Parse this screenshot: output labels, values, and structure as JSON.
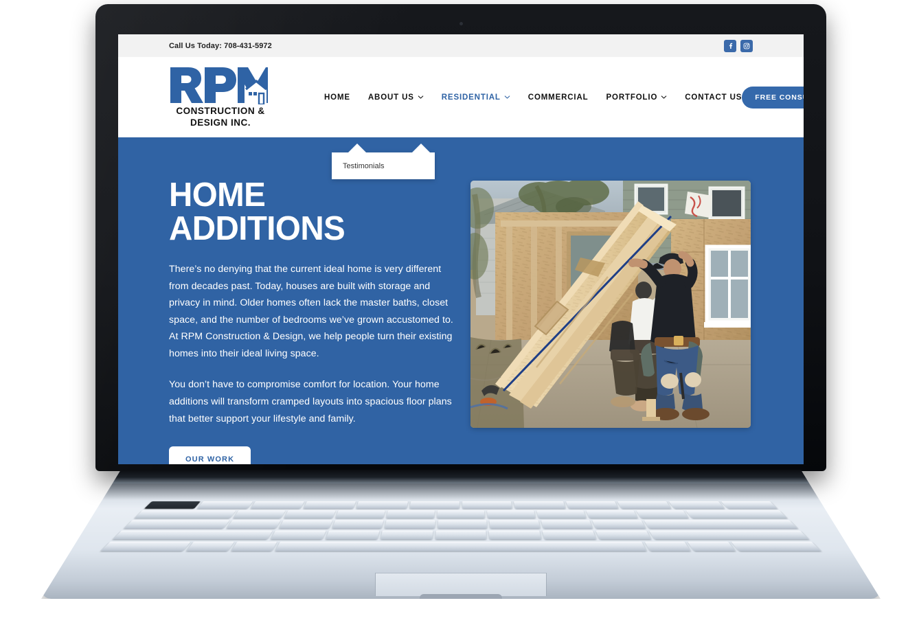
{
  "site": {
    "topbar": {
      "phone_label": "Call Us Today: 708-431-5972",
      "social": [
        {
          "name": "facebook",
          "glyph": "f"
        },
        {
          "name": "instagram",
          "glyph": "◎"
        }
      ]
    },
    "logo": {
      "mark_text": "RPM",
      "line1": "CONSTRUCTION &",
      "line2": "DESIGN INC."
    },
    "nav": {
      "items": [
        {
          "label": "HOME",
          "has_caret": false,
          "active": false
        },
        {
          "label": "ABOUT US",
          "has_caret": true,
          "active": false
        },
        {
          "label": "RESIDENTIAL",
          "has_caret": true,
          "active": true
        },
        {
          "label": "COMMERCIAL",
          "has_caret": false,
          "active": false
        },
        {
          "label": "PORTFOLIO",
          "has_caret": true,
          "active": false
        },
        {
          "label": "CONTACT US",
          "has_caret": false,
          "active": false
        }
      ],
      "cta_label": "FREE CONSULTATION"
    },
    "dropdown": {
      "items": [
        {
          "label": "Testimonials"
        }
      ]
    },
    "hero": {
      "title": "HOME ADDITIONS",
      "paragraph_1": "There’s no denying that the current ideal home is very different from decades past. Today, houses are built with storage and privacy in mind. Older homes often lack the master baths, closet space, and the number of bedrooms we’ve grown accustomed to. At RPM Construction & Design, we help people turn their existing homes into their ideal living space.",
      "paragraph_2": "You don’t have to compromise comfort for location. Your home additions will transform cramped layouts into spacious floor plans that better support your lifestyle and family.",
      "button_label": "OUR WORK",
      "image_alt": "Construction workers raising a framed wall with OSB sheathing at a home addition jobsite"
    },
    "colors": {
      "brand_blue": "#3063a4",
      "nav_active_blue": "#2f63a5",
      "cta_blue": "#3569ab",
      "topbar_gray": "#f2f2f2",
      "text_dark": "#111111",
      "white": "#ffffff"
    }
  }
}
